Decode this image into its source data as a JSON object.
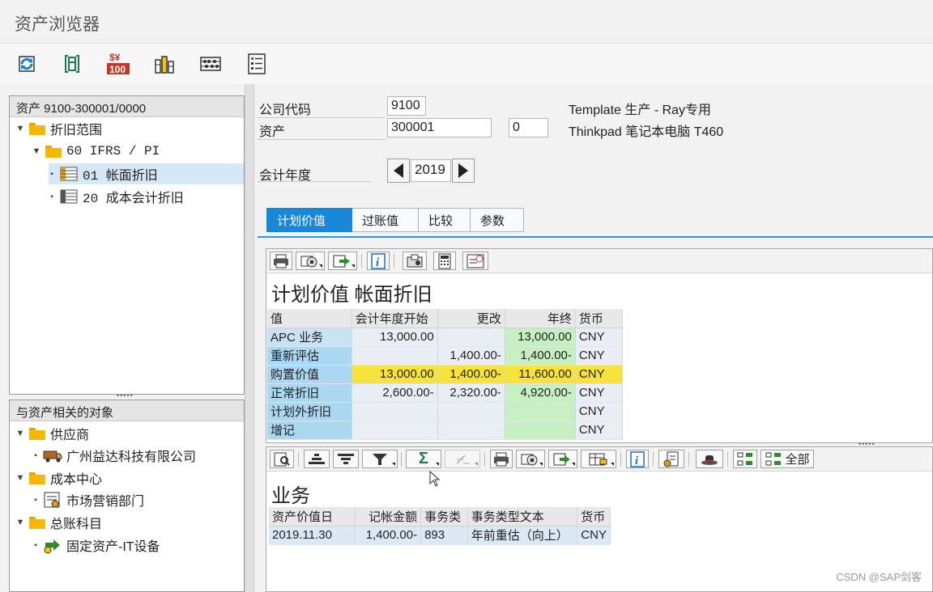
{
  "window": {
    "title": "资产浏览器"
  },
  "toolbar": {
    "buttons": [
      {
        "name": "refresh-icon"
      },
      {
        "name": "save-icon"
      },
      {
        "name": "currency-icon",
        "text": "$¥",
        "text2": "100"
      },
      {
        "name": "chart-icon"
      },
      {
        "name": "abacus-icon"
      },
      {
        "name": "list-icon"
      }
    ]
  },
  "tree": {
    "header": "资产 9100-300001/0000",
    "items": [
      {
        "label": "折旧范围"
      },
      {
        "label": "60 IFRS / PI"
      },
      {
        "label": "01 帐面折旧"
      },
      {
        "label": "20 成本会计折旧"
      }
    ]
  },
  "related": {
    "header": "与资产相关的对象",
    "groups": [
      {
        "label": "供应商",
        "child": "广州益达科技有限公司"
      },
      {
        "label": "成本中心",
        "child": "市场营销部门"
      },
      {
        "label": "总账科目",
        "child": "固定资产-IT设备"
      }
    ]
  },
  "header": {
    "company_label": "公司代码",
    "company_value": "9100",
    "company_text": "Template 生产 - Ray专用",
    "asset_label": "资产",
    "asset_value": "300001",
    "asset_sub": "0",
    "asset_text": "Thinkpad 笔记本电脑 T460",
    "year_label": "会计年度",
    "year_value": "2019"
  },
  "tabs": [
    "计划价值",
    "过账值",
    "比较",
    "参数"
  ],
  "planned": {
    "title": "计划价值 帐面折旧",
    "columns": [
      "值",
      "会计年度开始",
      "更改",
      "年终",
      "货币"
    ],
    "rows": [
      [
        "APC 业务",
        "13,000.00",
        "",
        "13,000.00",
        "CNY"
      ],
      [
        "重新评估",
        "",
        "1,400.00-",
        "1,400.00-",
        "CNY"
      ],
      [
        "购置价值",
        "13,000.00",
        "1,400.00-",
        "11,600.00",
        "CNY"
      ],
      [
        "正常折旧",
        "2,600.00-",
        "2,320.00-",
        "4,920.00-",
        "CNY"
      ],
      [
        "计划外折旧",
        "",
        "",
        "",
        "CNY"
      ],
      [
        "增记",
        "",
        "",
        "",
        "CNY"
      ]
    ]
  },
  "business": {
    "title": "业务",
    "toolbar_all": "全部",
    "sigma": "Σ",
    "columns": [
      "资产价值日",
      "记帐金额",
      "事务类",
      "事务类型文本",
      "货币"
    ],
    "rows": [
      [
        "2019.11.30",
        "1,400.00-",
        "893",
        "年前重估（向上）",
        "CNY"
      ]
    ]
  },
  "watermark": "CSDN @SAP剑客"
}
